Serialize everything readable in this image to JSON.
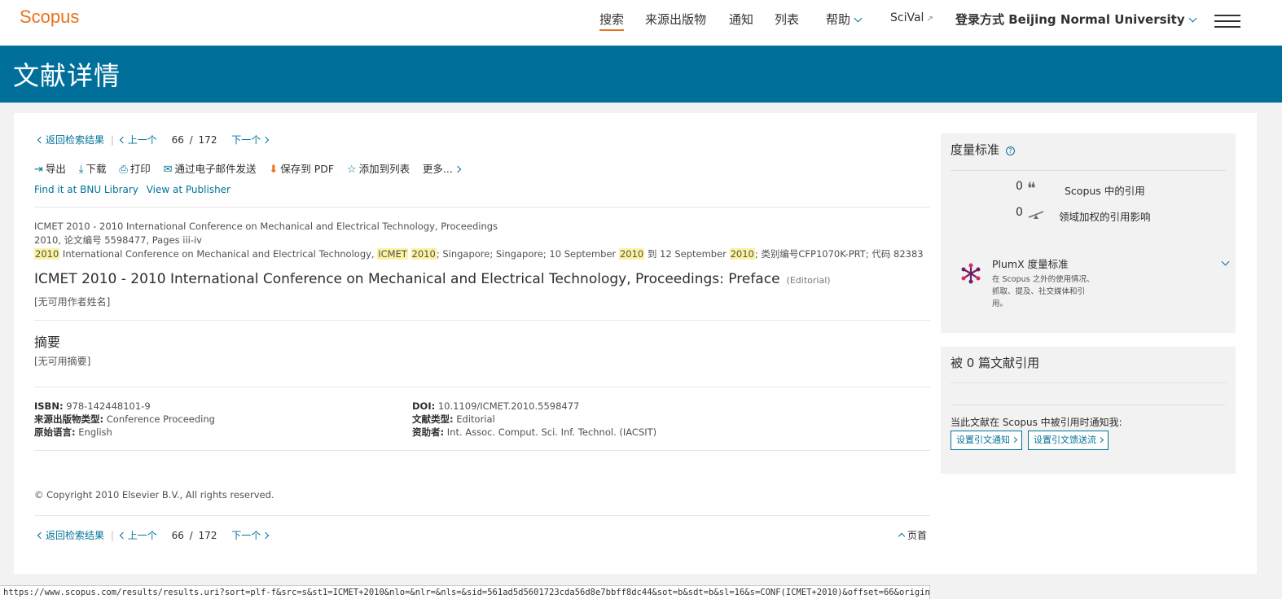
{
  "topbar": {
    "logo": "Scopus",
    "nav": {
      "search": "搜索",
      "sources": "来源出版物",
      "alerts": "通知",
      "lists": "列表",
      "help": "帮助",
      "scival": "SciVal",
      "login": "登录方式 Beijing Normal University"
    }
  },
  "banner": {
    "title": "文献详情"
  },
  "pager": {
    "back": "返回检索结果",
    "prev": "上一个",
    "current": "66",
    "slash": "/",
    "total": "172",
    "next": "下一个"
  },
  "toolbar": {
    "export": "导出",
    "download": "下载",
    "print": "打印",
    "email": "通过电子邮件发送",
    "pdf": "保存到 PDF",
    "addlist": "添加到列表",
    "more": "更多..."
  },
  "links": {
    "bnu": "Find it at BNU Library",
    "publisher": "View at Publisher"
  },
  "record": {
    "source": "ICMET 2010 - 2010 International Conference on Mechanical and Electrical Technology, Proceedings",
    "year_line": "2010, 论文编号 5598477, Pages iii-iv",
    "conf": {
      "h1": "2010",
      "t1": " International Conference on Mechanical and Electrical Technology, ",
      "h2": "ICMET",
      "h3": "2010",
      "t2": "; Singapore; Singapore; 10 September ",
      "h4": "2010",
      "t3": " 到 12 September ",
      "h5": "2010",
      "t4": "; 类别编号CFP1070K-PRT; 代码 82383"
    },
    "title": "ICMET 2010 - 2010 International Conference on Mechanical and Electrical Technology, Proceedings: Preface",
    "doc_tag": "(Editorial)",
    "authors": "[无可用作者姓名]"
  },
  "abstract": {
    "heading": "摘要",
    "text": "[无可用摘要]"
  },
  "details": {
    "isbn_label": "ISBN:",
    "isbn": "978-142448101-9",
    "source_type_label": "来源出版物类型:",
    "source_type": "Conference Proceeding",
    "lang_label": "原始语言:",
    "lang": "English",
    "doi_label": "DOI:",
    "doi": "10.1109/ICMET.2010.5598477",
    "doc_type_label": "文献类型:",
    "doc_type": "Editorial",
    "sponsor_label": "资助者:",
    "sponsor": "Int. Assoc. Comput. Sci. Inf. Technol. (IACSIT)"
  },
  "copyright": "© Copyright 2010 Elsevier B.V., All rights reserved.",
  "top_link": "页首",
  "metrics": {
    "heading": "度量标准",
    "help": "?",
    "citations_count": "0",
    "citations_label": "Scopus 中的引用",
    "fwci_count": "0",
    "fwci_label": "领域加权的引用影响",
    "plumx_title": "PlumX 度量标准",
    "plumx_desc_1": "在 Scopus 之外的使用情况、",
    "plumx_desc_2": "抓取、提及、社交媒体和引",
    "plumx_desc_3": "用。"
  },
  "cited_by": {
    "heading": "被 0 篇文献引用",
    "notify": "当此文献在 Scopus 中被引用时通知我:",
    "alert_btn": "设置引文通知",
    "feed_btn": "设置引文馈送流"
  },
  "statusbar": {
    "url": "https://www.scopus.com/results/results.uri?sort=plf-f&src=s&st1=ICMET+2010&nlo=&nlr=&nls=&sid=561ad5d5601723cda56d8e7bbff8dc44&sot=b&sdt=b&sl=16&s=CONF(ICMET+2010)&offset=66&origin=recordpage"
  }
}
